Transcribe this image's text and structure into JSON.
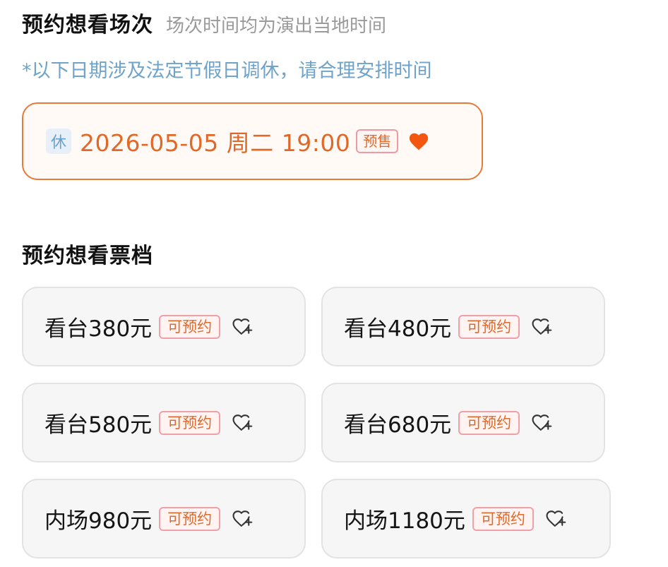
{
  "header": {
    "title": "预约想看场次",
    "subtitle": "场次时间均为演出当地时间"
  },
  "note": "*以下日期涉及法定节假日调休，请合理安排时间",
  "session": {
    "rest_badge": "休",
    "datetime": "2026-05-05 周二 19:00",
    "presale_badge": "预售",
    "favorited": true,
    "icon": "heart-filled-icon"
  },
  "tiers_title": "预约想看票档",
  "tiers": [
    {
      "label": "看台380元",
      "badge": "可预约",
      "icon": "heart-plus-icon"
    },
    {
      "label": "看台480元",
      "badge": "可预约",
      "icon": "heart-plus-icon"
    },
    {
      "label": "看台580元",
      "badge": "可预约",
      "icon": "heart-plus-icon"
    },
    {
      "label": "看台680元",
      "badge": "可预约",
      "icon": "heart-plus-icon"
    },
    {
      "label": "内场980元",
      "badge": "可预约",
      "icon": "heart-plus-icon"
    },
    {
      "label": "内场1180元",
      "badge": "可预约",
      "icon": "heart-plus-icon"
    }
  ],
  "colors": {
    "accent_orange": "#e0692a",
    "card_border_selected": "#e67a3a",
    "note_blue": "#6fa3c9",
    "badge_border_pink": "#f0a0a8"
  }
}
